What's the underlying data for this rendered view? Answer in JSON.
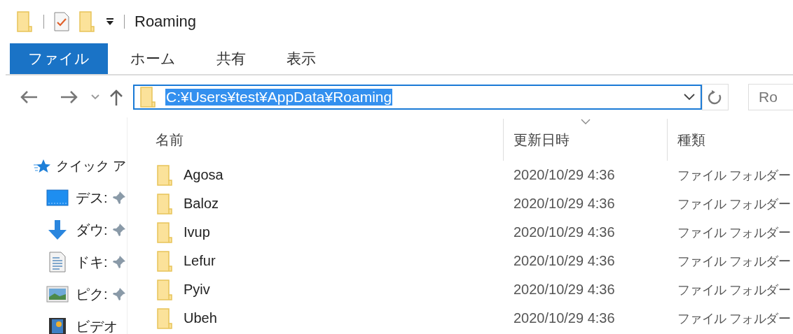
{
  "title_bar": {
    "title": "Roaming"
  },
  "ribbon_tabs": [
    {
      "label": "ファイル",
      "selected": true
    },
    {
      "label": "ホーム",
      "selected": false
    },
    {
      "label": "共有",
      "selected": false
    },
    {
      "label": "表示",
      "selected": false
    }
  ],
  "address_bar": {
    "value": "C:¥Users¥test¥AppData¥Roaming",
    "text_selected": true
  },
  "search_box": {
    "placeholder": "Ro"
  },
  "sidebar": {
    "items": [
      {
        "kind": "star",
        "label": "クイック ア",
        "pinned": false
      },
      {
        "kind": "desktop",
        "label": "デス:",
        "pinned": true
      },
      {
        "kind": "download",
        "label": "ダウ:",
        "pinned": true
      },
      {
        "kind": "document",
        "label": "ドキ:",
        "pinned": true
      },
      {
        "kind": "picture",
        "label": "ピク:",
        "pinned": true
      },
      {
        "kind": "video",
        "label": "ビデオ",
        "pinned": false
      }
    ]
  },
  "file_list": {
    "columns": [
      {
        "label": "名前",
        "sorted": false
      },
      {
        "label": "更新日時",
        "sorted": true
      },
      {
        "label": "種類",
        "sorted": false
      }
    ],
    "rows": [
      {
        "name": "Agosa",
        "modified": "2020/10/29 4:36",
        "type": "ファイル フォルダー"
      },
      {
        "name": "Baloz",
        "modified": "2020/10/29 4:36",
        "type": "ファイル フォルダー"
      },
      {
        "name": "Ivup",
        "modified": "2020/10/29 4:36",
        "type": "ファイル フォルダー"
      },
      {
        "name": "Lefur",
        "modified": "2020/10/29 4:36",
        "type": "ファイル フォルダー"
      },
      {
        "name": "Pyiv",
        "modified": "2020/10/29 4:36",
        "type": "ファイル フォルダー"
      },
      {
        "name": "Ubeh",
        "modified": "2020/10/29 4:36",
        "type": "ファイル フォルダー"
      }
    ]
  }
}
